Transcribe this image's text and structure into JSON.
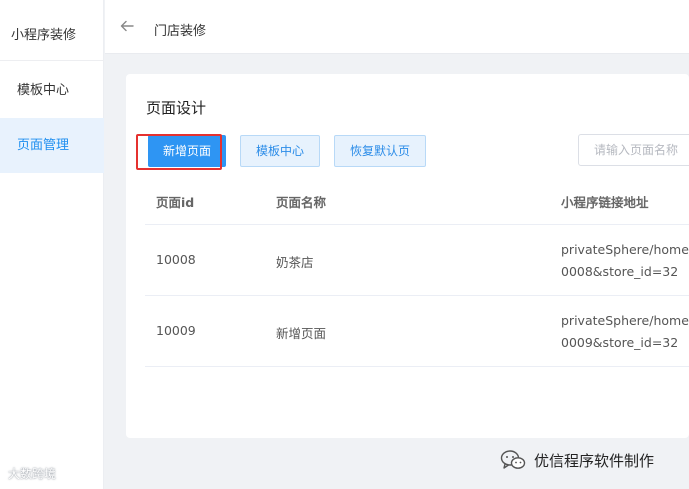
{
  "sidebar": {
    "title": "小程序装修",
    "items": [
      {
        "label": "模板中心",
        "active": false
      },
      {
        "label": "页面管理",
        "active": true
      }
    ]
  },
  "header": {
    "back_icon": "arrow-left-icon",
    "title": "门店装修"
  },
  "main": {
    "title": "页面设计",
    "buttons": {
      "add_page": "新增页面",
      "template_center": "模板中心",
      "restore_default": "恢复默认页"
    },
    "search": {
      "value": "",
      "placeholder": "请输入页面名称"
    },
    "table": {
      "columns": [
        "页面id",
        "页面名称",
        "小程序链接地址"
      ],
      "rows": [
        {
          "id": "10008",
          "name": "奶茶店",
          "url_line1": "privateSphere/home/",
          "url_line2": "0008&store_id=32"
        },
        {
          "id": "10009",
          "name": "新增页面",
          "url_line1": "privateSphere/home/",
          "url_line2": "0009&store_id=32"
        }
      ]
    }
  },
  "watermarks": {
    "left": "大数跨境",
    "right": "优信程序软件制作",
    "right_icon": "wechat-icon"
  },
  "colors": {
    "primary": "#2e95f3",
    "highlight": "#e5312f",
    "active_bg": "#e8f2fd"
  }
}
